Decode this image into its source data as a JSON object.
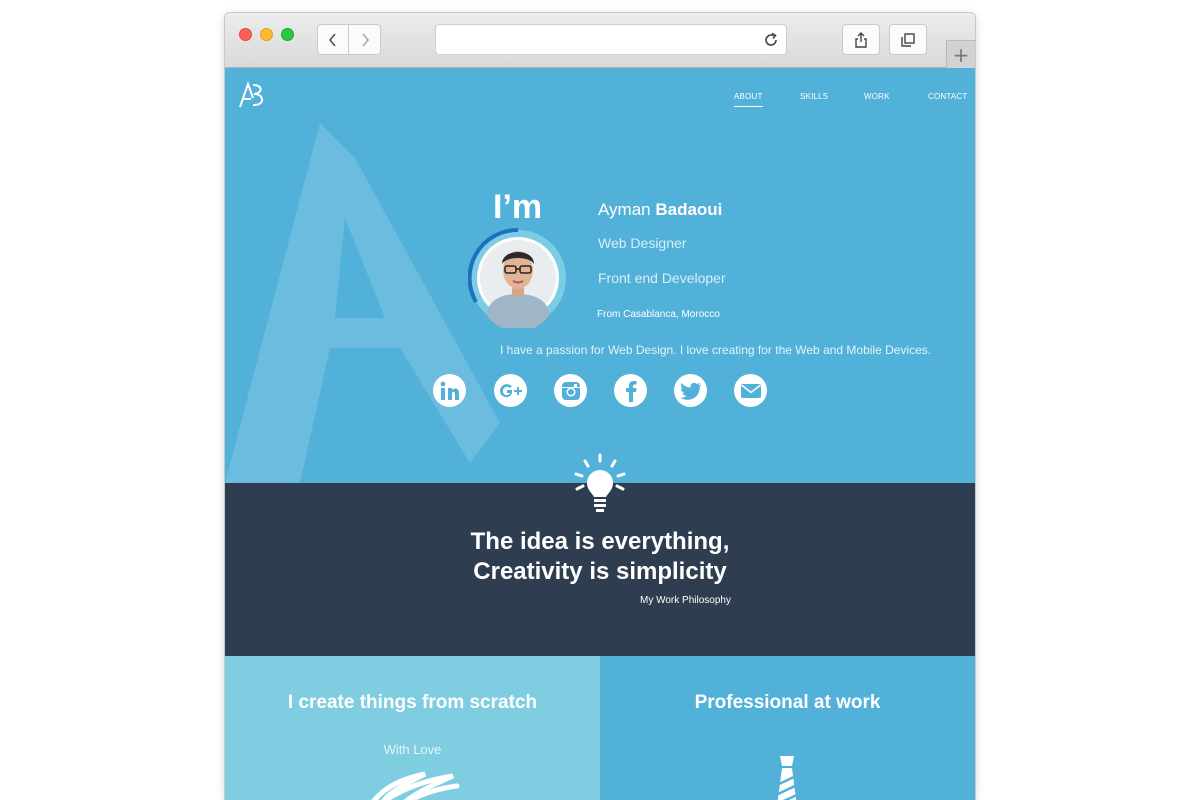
{
  "browser": {
    "back_icon": "chevron-left-icon",
    "forward_icon": "chevron-right-icon",
    "reload_icon": "reload-icon",
    "share_icon": "share-icon",
    "tabs_icon": "tabs-icon",
    "new_tab_label": "+"
  },
  "nav": {
    "items": [
      {
        "label": "ABOUT",
        "active": true
      },
      {
        "label": "SKILLS",
        "active": false
      },
      {
        "label": "WORK",
        "active": false
      },
      {
        "label": "CONTACT",
        "active": false
      }
    ]
  },
  "hero": {
    "im": "I’m",
    "first_name": "Ayman",
    "last_name": "Badaoui",
    "role1": "Web Designer",
    "role2": "Front end Developer",
    "location": "From Casablanca, Morocco",
    "passion": "I have a passion for Web Design. I love creating for the Web and Mobile Devices.",
    "socials": [
      "linkedin-icon",
      "google-plus-icon",
      "instagram-icon",
      "facebook-icon",
      "twitter-icon",
      "email-icon"
    ]
  },
  "philosophy": {
    "line1": "The idea is everything,",
    "line2": "Creativity is simplicity",
    "caption": "My Work Philosophy"
  },
  "panels": {
    "left_title": "I create things from scratch",
    "left_sub": "With Love",
    "right_title": "Professional at work"
  },
  "colors": {
    "hero_bg": "#52b1d9",
    "dark_bg": "#2e3d50",
    "panel_left_bg": "#7ecde1",
    "panel_right_bg": "#52b1d9"
  }
}
